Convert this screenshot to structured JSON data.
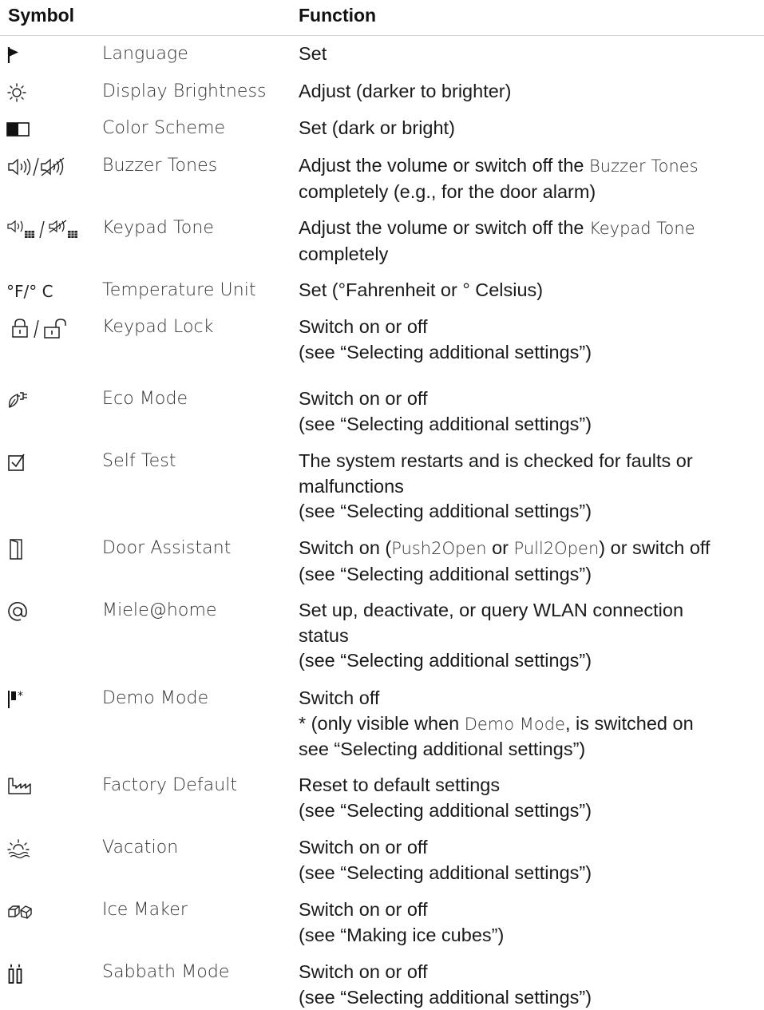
{
  "table": {
    "headers": {
      "symbol": "Symbol",
      "function": "Function"
    },
    "rows": [
      {
        "icon": "flag-icon",
        "name": "Language",
        "function_lines": [
          "Set"
        ]
      },
      {
        "icon": "sun-icon",
        "name": "Display Brightness",
        "function_lines": [
          "Adjust (darker to brighter)"
        ]
      },
      {
        "icon": "half-filled-square-icon",
        "name": "Color Scheme",
        "function_lines": [
          "Set (dark or bright)"
        ]
      },
      {
        "icon": "speaker-mute-icon",
        "name": "Buzzer Tones",
        "function_parts": {
          "before": "Adjust the volume or switch off the ",
          "ui": "Buzzer Tones",
          "line2": "completely (e.g., for the door alarm)"
        }
      },
      {
        "icon": "keypad-speaker-icon",
        "name": "Keypad Tone",
        "function_parts": {
          "before": "Adjust the volume or switch off the ",
          "ui": "Keypad Tone",
          "line2": "completely"
        }
      },
      {
        "icon": "temperature-unit-icon",
        "symbol_text": "°F/° C",
        "name": "Temperature Unit",
        "function_lines": [
          "Set (°Fahrenheit or ° Celsius)"
        ]
      },
      {
        "icon": "lock-unlock-icon",
        "name": "Keypad Lock",
        "function_lines": [
          "Switch on or off",
          "(see “Selecting additional settings”)"
        ]
      },
      {
        "icon": "leaf-plug-icon",
        "name": "Eco Mode",
        "function_lines": [
          "Switch on or off",
          "(see “Selecting additional settings”)"
        ]
      },
      {
        "icon": "checkbox-icon",
        "name": "Self Test",
        "function_lines": [
          "The system restarts and is checked for faults or",
          "malfunctions",
          "(see “Selecting additional settings”)"
        ]
      },
      {
        "icon": "door-icon",
        "name": "Door Assistant",
        "function_parts": {
          "a": "Switch on (",
          "ui1": "Push2Open",
          "b": " or ",
          "ui2": "Pull2Open",
          "c": ") or switch off",
          "line2": "(see “Selecting additional settings”)"
        }
      },
      {
        "icon": "at-sign-icon",
        "name": "Miele@home",
        "function_lines": [
          "Set up, deactivate, or query WLAN connection",
          "status",
          "(see “Selecting additional settings”)"
        ]
      },
      {
        "icon": "demo-flag-icon",
        "name": "Demo Mode",
        "function_parts": {
          "line1": "Switch off",
          "a": "* (only visible when ",
          "ui": "Demo Mode",
          "b": ", is switched on",
          "line3": "see “Selecting additional settings”)"
        }
      },
      {
        "icon": "factory-icon",
        "name": "Factory Default",
        "function_lines": [
          "Reset to default settings",
          "(see “Selecting additional settings”)"
        ]
      },
      {
        "icon": "sunset-icon",
        "name": "Vacation",
        "function_lines": [
          "Switch on or off",
          "(see “Selecting additional settings”)"
        ]
      },
      {
        "icon": "ice-cubes-icon",
        "name": "Ice Maker",
        "function_lines": [
          "Switch on or off",
          "(see “Making ice cubes”)"
        ]
      },
      {
        "icon": "candles-icon",
        "name": "Sabbath Mode",
        "function_lines": [
          "Switch on or off",
          "(see “Selecting additional settings”)"
        ]
      }
    ]
  }
}
